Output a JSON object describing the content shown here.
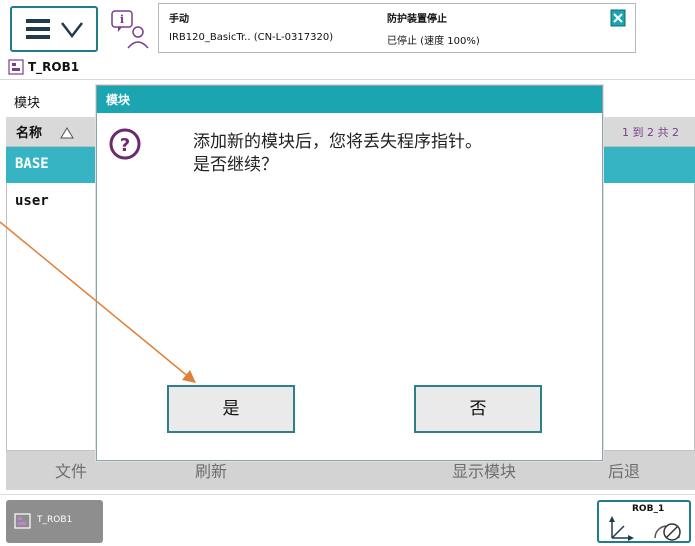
{
  "status": {
    "mode": "手动",
    "robot": "IRB120_BasicTr.. (CN-L-0317320)",
    "guard": "防护装置停止",
    "speed": "已停止 (速度 100%)"
  },
  "task_title": "T_ROB1",
  "module_view": {
    "tab_label": "模块",
    "column_name": "名称",
    "page_count": "1 到 2 共 2",
    "rows": [
      "BASE",
      "user"
    ],
    "selected_row": "BASE"
  },
  "toolbar": {
    "file": "文件",
    "refresh": "刷新",
    "show_module": "显示模块",
    "back": "后退"
  },
  "taskbar": {
    "task": "T_ROB1",
    "robot": "ROB_1"
  },
  "dialog": {
    "title": "模块",
    "message_line1": "添加新的模块后，您将丢失程序指针。",
    "message_line2": "是否继续？",
    "yes_label": "是",
    "no_label": "否"
  },
  "colors": {
    "accent": "#1aa5b0",
    "selection": "#36b4c3",
    "annotation_arrow": "#e0803a"
  },
  "icons": [
    "menu-icon",
    "chevron-down-icon",
    "info-icon",
    "close-icon",
    "task-icon",
    "sort-up-icon",
    "question-icon",
    "axes-icon",
    "speed-icon"
  ]
}
